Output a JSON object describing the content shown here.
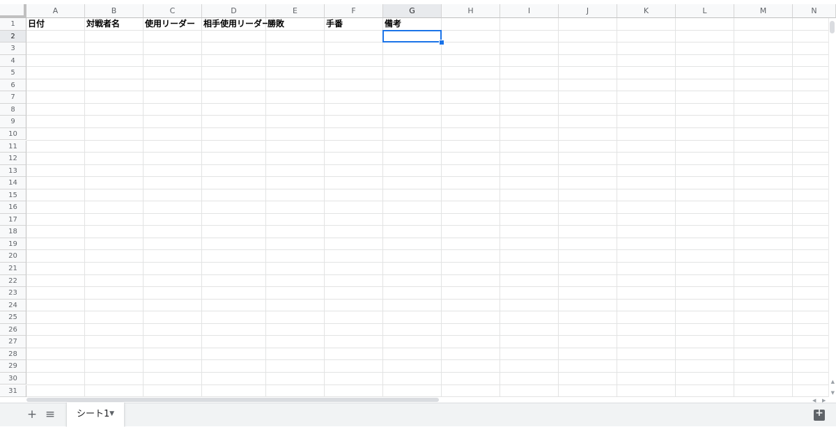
{
  "columns": [
    "A",
    "B",
    "C",
    "D",
    "E",
    "F",
    "G",
    "H",
    "I",
    "J",
    "K",
    "L",
    "M",
    "N"
  ],
  "rows": [
    1,
    2,
    3,
    4,
    5,
    6,
    7,
    8,
    9,
    10,
    11,
    12,
    13,
    14,
    15,
    16,
    17,
    18,
    19,
    20,
    21,
    22,
    23,
    24,
    25,
    26,
    27,
    28,
    29,
    30,
    31
  ],
  "headers": [
    "日付",
    "対戦者名",
    "使用リーダー",
    "相手使用リーダー",
    "勝敗",
    "手番",
    "備考"
  ],
  "selection": {
    "cell": "G2"
  },
  "bottom": {
    "add_icon": "+",
    "list_icon": "≡",
    "sheet_tab": "シート1",
    "sheet_caret": "▼"
  },
  "colors": {
    "selection": "#1a73e8"
  }
}
